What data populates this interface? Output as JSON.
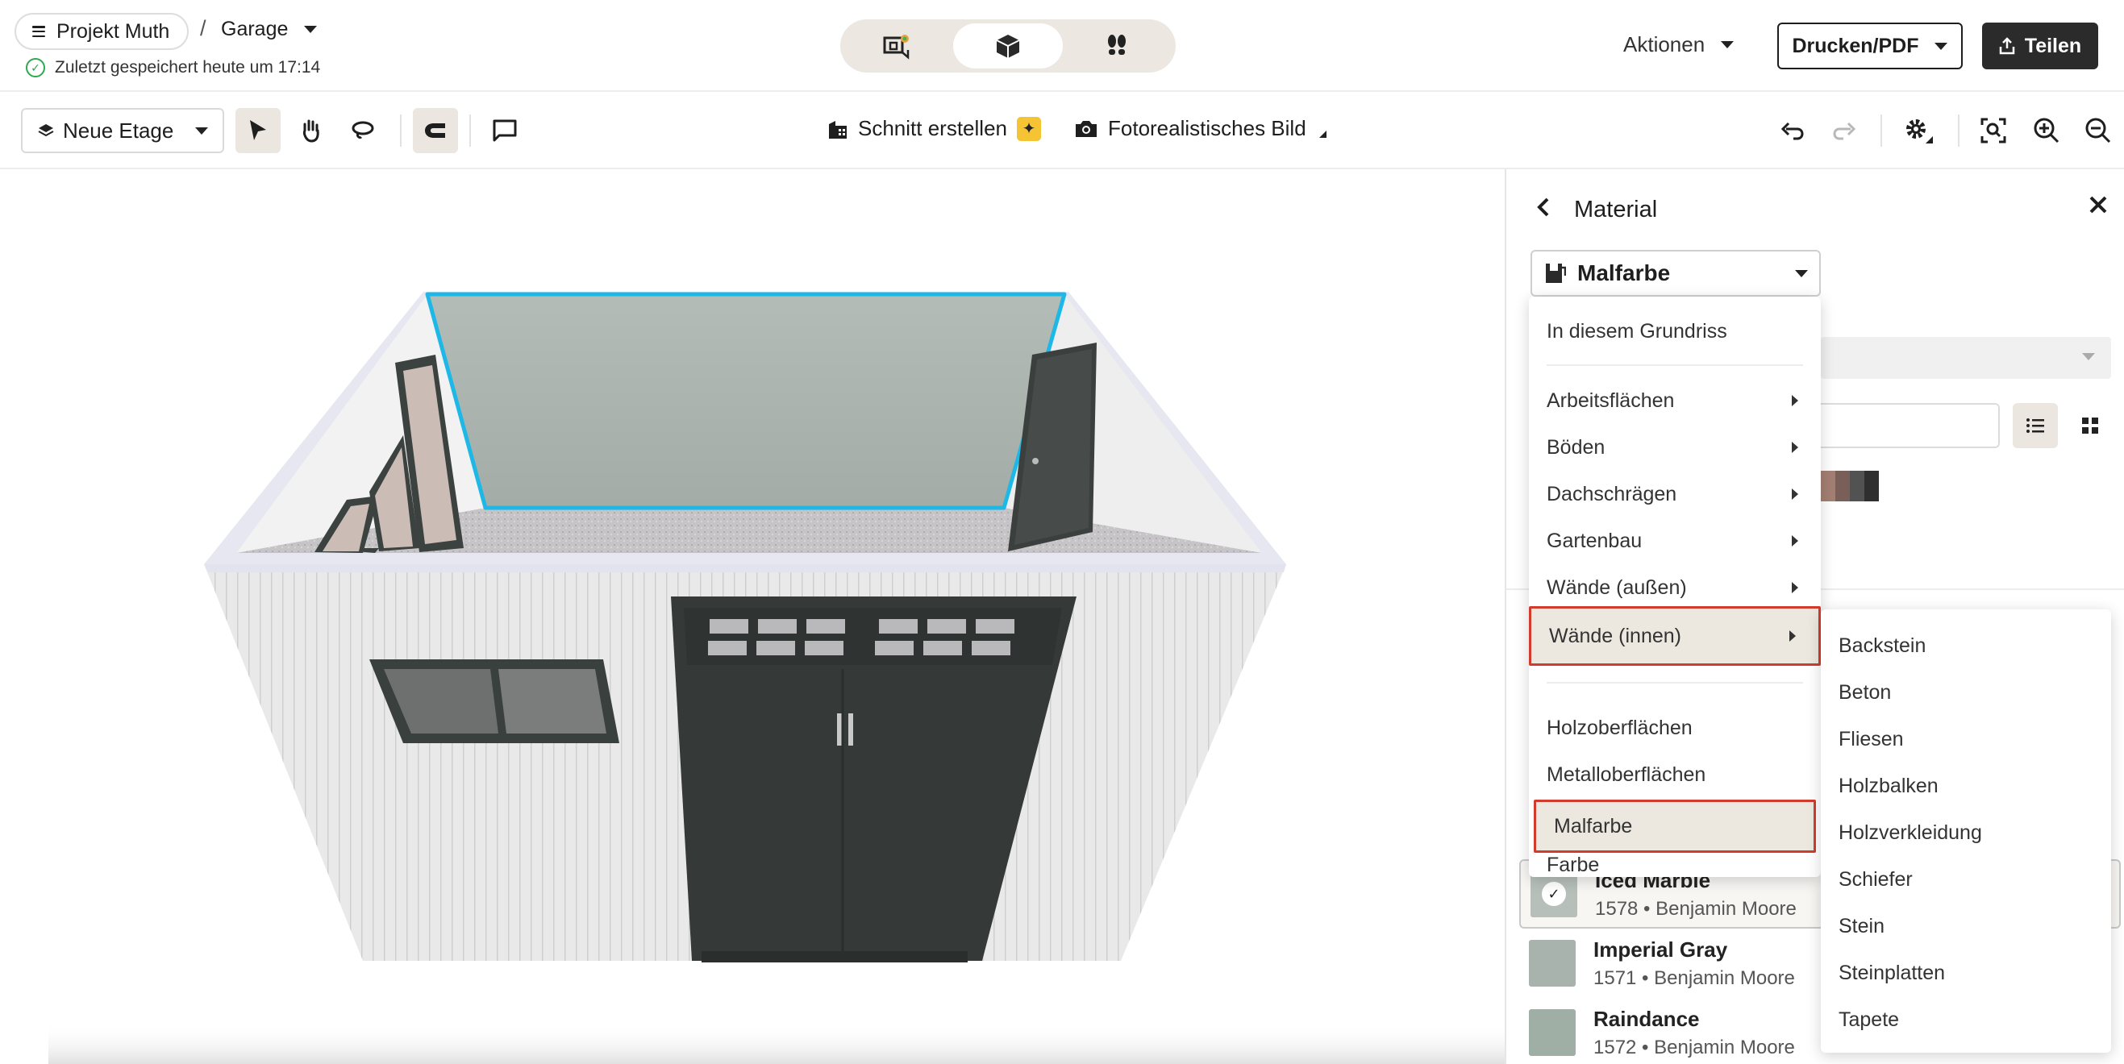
{
  "header": {
    "project_label": "Projekt Muth",
    "separator": "/",
    "floor_label": "Garage",
    "saved_status": "Zuletzt gespeichert heute um 17:14",
    "view_modes": [
      "2d-3d-icon",
      "3d-box-icon",
      "walkthrough-icon"
    ],
    "actions_label": "Aktionen",
    "print_label": "Drucken/PDF",
    "share_label": "Teilen"
  },
  "toolbar": {
    "new_floor_label": "Neue Etage",
    "section_label": "Schnitt erstellen",
    "photo_label": "Fotorealistisches Bild"
  },
  "panel": {
    "title": "Material",
    "selected_material": "Malfarbe",
    "colors": [
      {
        "name": "Iced Marble",
        "meta": "1578 • Benjamin Moore",
        "hex": "#b7bfbb",
        "selected": true
      },
      {
        "name": "Imperial Gray",
        "meta": "1571 • Benjamin Moore",
        "hex": "#a9b3ad",
        "selected": false
      },
      {
        "name": "Raindance",
        "meta": "1572 • Benjamin Moore",
        "hex": "#9fae a6",
        "selected": false
      }
    ]
  },
  "menu": {
    "items": [
      {
        "label": "In diesem Grundriss",
        "submenu": false
      },
      {
        "label": "Arbeitsflächen",
        "submenu": true
      },
      {
        "label": "Böden",
        "submenu": true
      },
      {
        "label": "Dachschrägen",
        "submenu": true
      },
      {
        "label": "Gartenbau",
        "submenu": true
      },
      {
        "label": "Wände (außen)",
        "submenu": true
      },
      {
        "label": "Wände (innen)",
        "submenu": true
      },
      {
        "label": "Holzoberflächen",
        "submenu": false
      },
      {
        "label": "Metalloberflächen",
        "submenu": false
      },
      {
        "label": "Malfarbe",
        "submenu": false
      },
      {
        "label": "Farbe",
        "submenu": false
      }
    ]
  },
  "submenu": {
    "items": [
      "Backstein",
      "Beton",
      "Fliesen",
      "Holzbalken",
      "Holzverkleidung",
      "Schiefer",
      "Stein",
      "Steinplatten",
      "Tapete"
    ]
  },
  "colors": {
    "accent_highlight": "#1eb8e6",
    "menu_outline": "#d23c2c",
    "saved_green": "#2ea84f",
    "share_button": "#2b2b2b"
  }
}
